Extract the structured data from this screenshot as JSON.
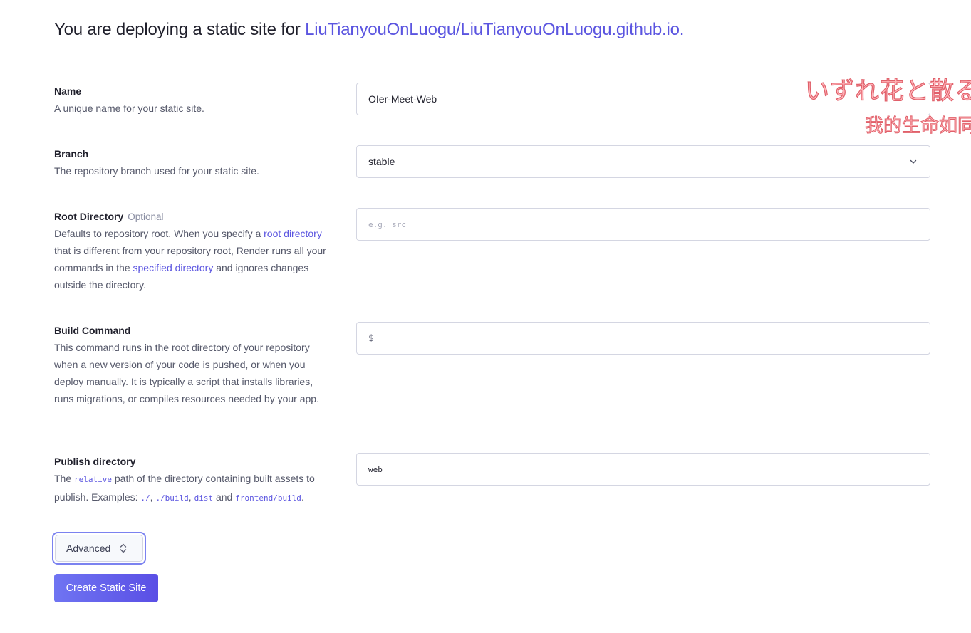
{
  "header": {
    "prefix": "You are deploying a static site for ",
    "repo": "LiuTianyouOnLuogu/LiuTianyouOnLuogu.github.io."
  },
  "name_field": {
    "label": "Name",
    "description": "A unique name for your static site.",
    "value": "OIer-Meet-Web"
  },
  "branch_field": {
    "label": "Branch",
    "description": "The repository branch used for your static site.",
    "value": "stable"
  },
  "root_dir_field": {
    "label": "Root Directory",
    "optional": "Optional",
    "desc_part1": "Defaults to repository root. When you specify a ",
    "link1": "root directory",
    "desc_part2": " that is different from your repository root, Render runs all your commands in the ",
    "link2": "specified directory",
    "desc_part3": " and ignores changes outside the directory.",
    "placeholder": "e.g. src",
    "value": ""
  },
  "build_field": {
    "label": "Build Command",
    "description": "This command runs in the root directory of your repository when a new version of your code is pushed, or when you deploy manually. It is typically a script that installs libraries, runs migrations, or compiles resources needed by your app.",
    "prefix": "$",
    "value": ""
  },
  "publish_field": {
    "label": "Publish directory",
    "desc_the": "The ",
    "code_relative": "relative",
    "desc_mid": " path of the directory containing built assets to publish. Examples: ",
    "code_ex1": "./",
    "comma1": ", ",
    "code_ex2": "./build",
    "comma2": ", ",
    "code_ex3": "dist",
    "and": " and ",
    "code_ex4": "frontend/build",
    "period": ".",
    "value": "web"
  },
  "advanced_button": "Advanced",
  "create_button": "Create Static Site",
  "overlay": {
    "japanese": "いずれ花と散る",
    "chinese": "我的生命如同"
  },
  "icons": {
    "branch_select": "chevron-down-icon",
    "advanced_toggle": "chevron-up-down-icon"
  },
  "colors": {
    "accent": "#5b55e0",
    "button_gradient_start": "#6f74f2",
    "button_gradient_end": "#5a4fe5",
    "focus_ring": "#7b82f0"
  }
}
